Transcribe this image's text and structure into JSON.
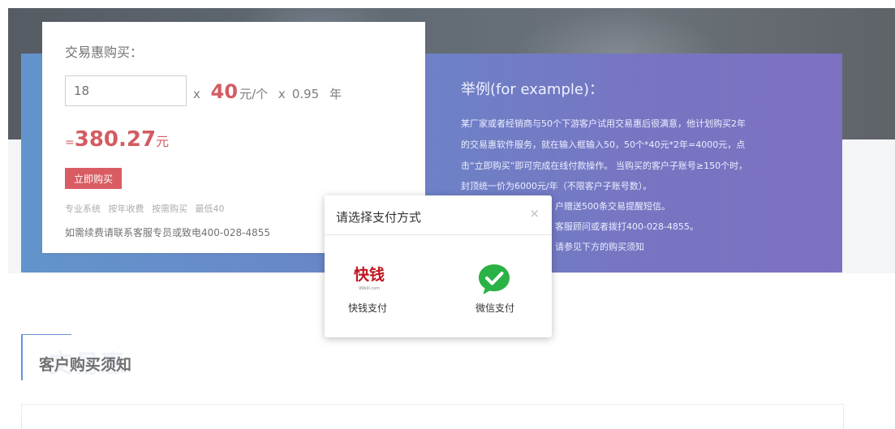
{
  "purchase": {
    "title": "交易惠购买：",
    "quantity_value": "18",
    "multiply1": "x",
    "price": "40",
    "price_unit": "元/个",
    "multiply2": "x",
    "years": "0.95",
    "years_unit": "年",
    "total_prefix": "=",
    "total_amount": "380.27",
    "total_unit": "元",
    "buy_button": "立即购买",
    "tags": [
      "专业系统",
      "按年收费",
      "按需购买",
      "最低40"
    ],
    "contact": "如需续费请联系客服专员或致电400-028-4855"
  },
  "example": {
    "title": "举例(for example)：",
    "lines": [
      "某厂家或者经销商与50个下游客户试用交易惠后很满意，他计划购买2年",
      "的交易惠软件服务，就在输入框输入50，50个*40元*2年=4000元，点",
      "击“立即购买”即可完成在线付款操作。 当购买的客户子账号≥150个时，",
      "封顶统一价为6000元/年（不限客户子账号数）。",
      "户赠送500条交易提醒短信。",
      "客服顾问或者拨打400-028-4855。",
      "请参见下方的购买须知"
    ]
  },
  "notice": {
    "title": "客户购买须知",
    "bg_text": "交易惠"
  },
  "dialog": {
    "title": "请选择支付方式",
    "close": "×",
    "options": [
      {
        "label": "快钱支付",
        "icon": "kuaiqian-logo-icon",
        "logo_text": "快钱",
        "logo_sub": "99bill.com"
      },
      {
        "label": "微信支付",
        "icon": "wechat-pay-icon"
      }
    ]
  },
  "colors": {
    "accent_red": "#c0161f",
    "band_start": "#1f67b5",
    "band_end": "#4534a6",
    "wechat_green": "#2bb246"
  }
}
